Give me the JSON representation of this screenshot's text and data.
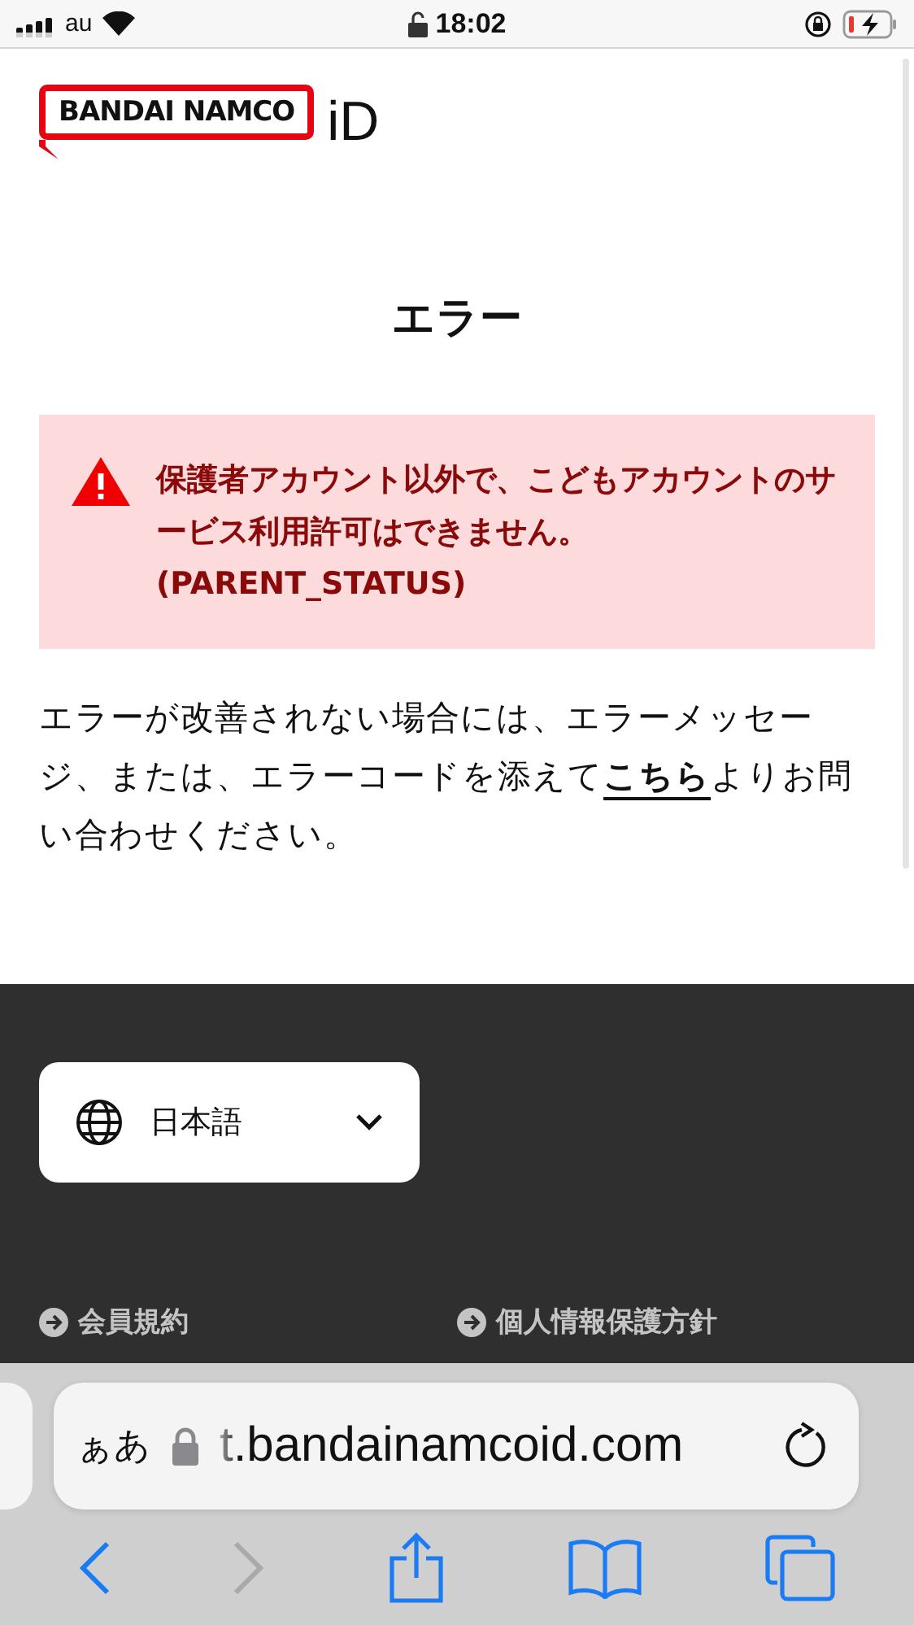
{
  "status_bar": {
    "carrier": "au",
    "time": "18:02"
  },
  "logo": {
    "brand": "BANDAI NAMCO",
    "suffix": "iD"
  },
  "title": "エラー",
  "alert": {
    "message": "保護者アカウント以外で、こどもアカウントのサービス利用許可はできません。",
    "code": "(PARENT_STATUS)"
  },
  "help": {
    "before": "エラーが改善されない場合には、エラーメッセージ、または、エラーコードを添えて",
    "link": "こちら",
    "after": "よりお問い合わせください。"
  },
  "footer": {
    "language": "日本語",
    "links": [
      "会員規約",
      "個人情報保護方針"
    ]
  },
  "browser": {
    "text_size": "ぁあ",
    "url": "t.bandainamcoid.com",
    "back_disabled": false,
    "forward_disabled": true
  }
}
